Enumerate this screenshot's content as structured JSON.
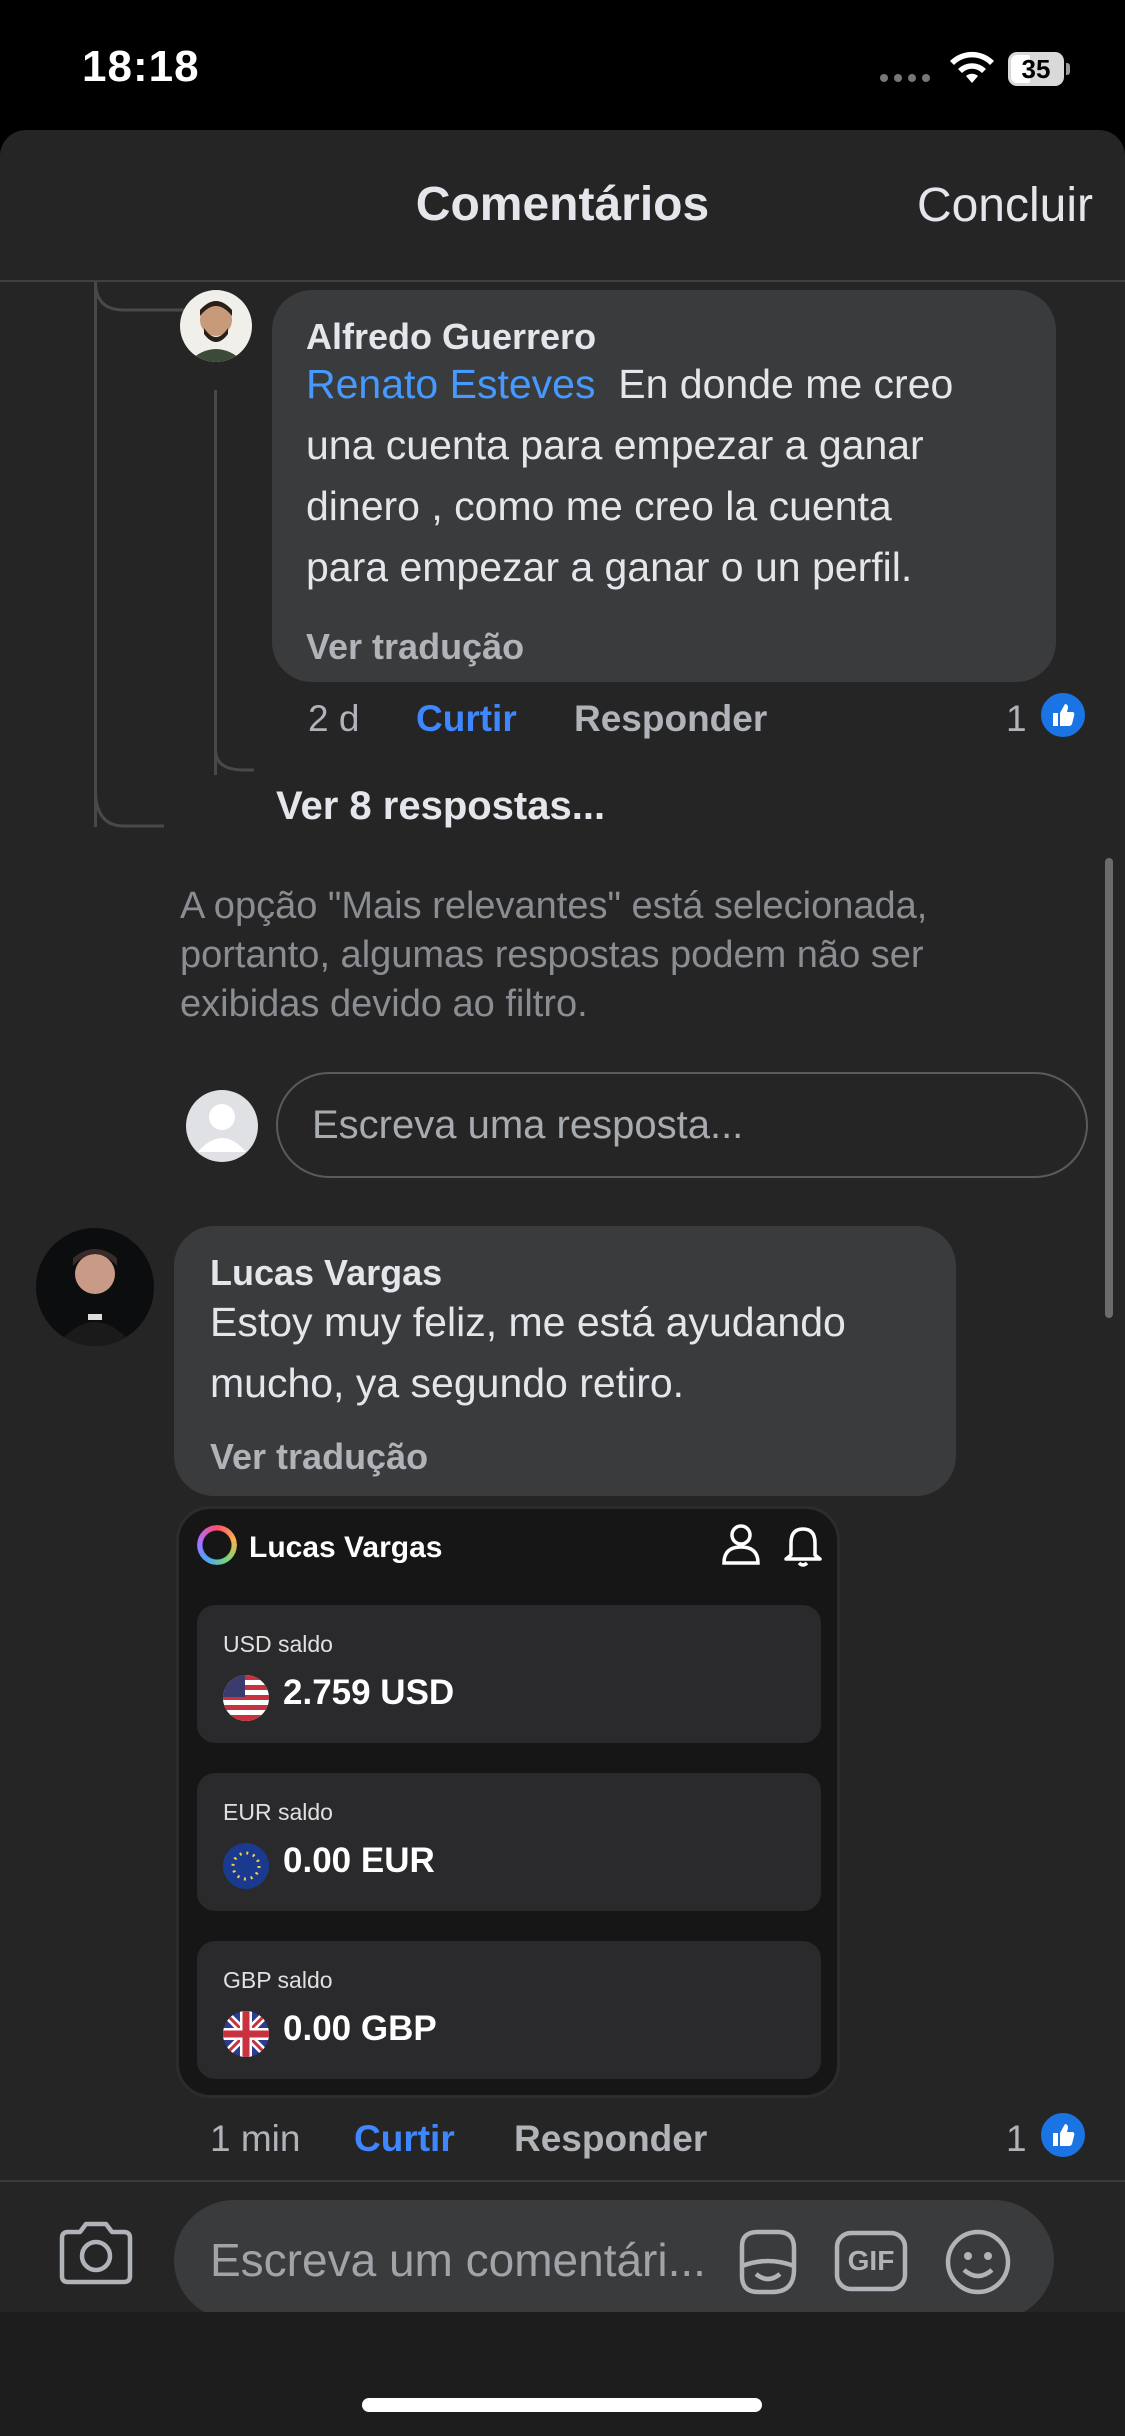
{
  "status_bar": {
    "time": "18:18",
    "battery": "35"
  },
  "header": {
    "title": "Comentários",
    "done_label": "Concluir"
  },
  "reply_comment": {
    "author": "Alfredo Guerrero",
    "mention": "Renato Esteves",
    "text_lines": [
      "En donde me creo",
      "una cuenta para empezar a ganar",
      "dinero , como me creo la cuenta",
      "para empezar a ganar o un perfil."
    ],
    "translate_label": "Ver tradução",
    "time": "2 d",
    "like_label": "Curtir",
    "reply_label": "Responder",
    "like_count": "1"
  },
  "thread": {
    "view_replies": "Ver 8 respostas...",
    "filter_note_lines": [
      "A opção \"Mais relevantes\" está selecionada,",
      "portanto, algumas respostas podem não ser",
      "exibidas devido ao filtro."
    ],
    "reply_placeholder": "Escreva uma resposta..."
  },
  "comment": {
    "author": "Lucas Vargas",
    "text_lines": [
      "Estoy muy feliz, me está ayudando",
      "mucho, ya segundo retiro."
    ],
    "translate_label": "Ver tradução",
    "time": "1 min",
    "like_label": "Curtir",
    "reply_label": "Responder",
    "like_count": "1"
  },
  "attachment": {
    "name": "Lucas Vargas",
    "balances": [
      {
        "label": "USD saldo",
        "amount": "2.759 USD",
        "flag": "us-flag-icon"
      },
      {
        "label": "EUR saldo",
        "amount": "0.00 EUR",
        "flag": "eu-flag-icon"
      },
      {
        "label": "GBP saldo",
        "amount": "0.00 GBP",
        "flag": "uk-flag-icon"
      }
    ]
  },
  "composer": {
    "placeholder": "Escreva um comentári...",
    "gif_label": "GIF"
  },
  "colors": {
    "link": "#4599ff",
    "like_blue": "#1b74e4",
    "action_blue": "#3e87ff",
    "bubble": "#3a3b3c",
    "sheet": "#252526"
  }
}
